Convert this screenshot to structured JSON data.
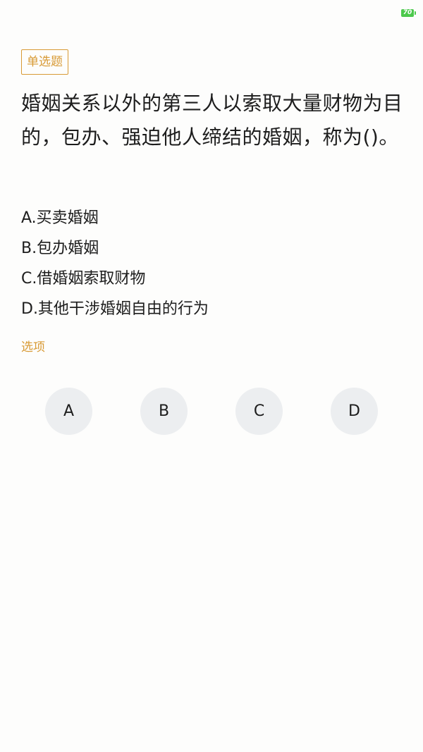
{
  "status_bar": {
    "battery_level": "70",
    "battery_color": "#4cc94c"
  },
  "question": {
    "type_tag": "单选题",
    "text": "婚姻关系以外的第三人以索取大量财物为目的，包办、强迫他人缔结的婚姻，称为()。",
    "options": [
      {
        "letter": "A",
        "text": "A.买卖婚姻"
      },
      {
        "letter": "B",
        "text": "B.包办婚姻"
      },
      {
        "letter": "C",
        "text": "C.借婚姻索取财物"
      },
      {
        "letter": "D",
        "text": "D.其他干涉婚姻自由的行为"
      }
    ]
  },
  "answer_section": {
    "label": "选项",
    "buttons": [
      "A",
      "B",
      "C",
      "D"
    ]
  },
  "colors": {
    "accent": "#d89a35",
    "text": "#1d1d1d",
    "button_bg": "#eceef0"
  }
}
